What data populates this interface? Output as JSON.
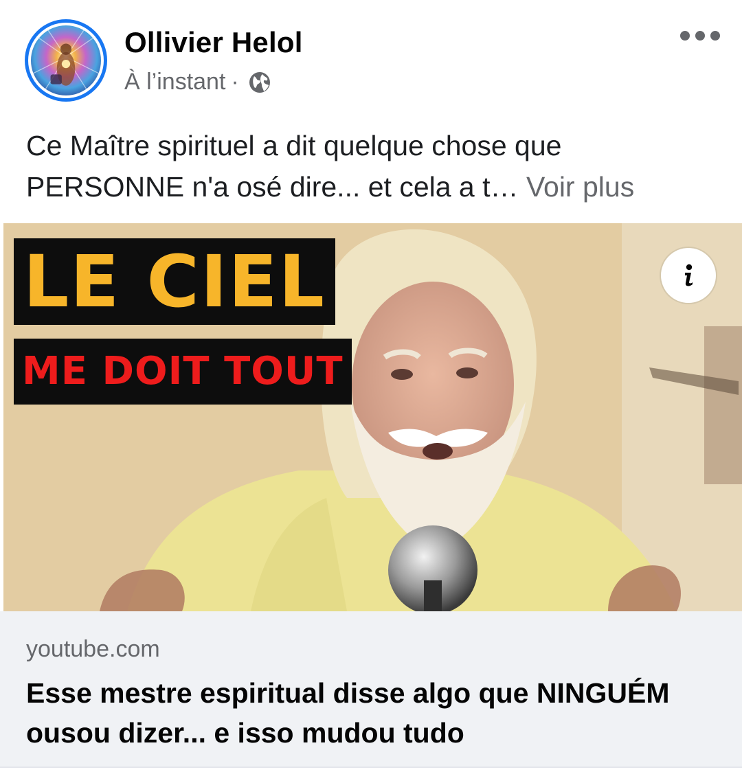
{
  "post": {
    "author": "Ollivier Helol",
    "timestamp": "À l’instant",
    "separator": "·",
    "audience_icon": "globe-icon",
    "more_icon": "more-horizontal-icon",
    "text": "Ce Maître spirituel a dit quelque chose que PERSONNE n'a osé dire... et cela a t…",
    "see_more_label": "Voir plus"
  },
  "media": {
    "overlay_line1": "LE CIEL",
    "overlay_line2": "ME DOIT TOUT",
    "info_icon": "info-icon",
    "colors": {
      "line1": "#f7b52a",
      "line2": "#ee1c1c",
      "box": "#0d0d0d"
    }
  },
  "link_preview": {
    "domain": "youtube.com",
    "title": "Esse mestre espiritual disse algo que NINGUÉM ousou dizer... e isso mudou tudo"
  },
  "colors": {
    "accent": "#1877f2",
    "secondary_text": "#65676b",
    "footer_bg": "#f0f2f5"
  }
}
